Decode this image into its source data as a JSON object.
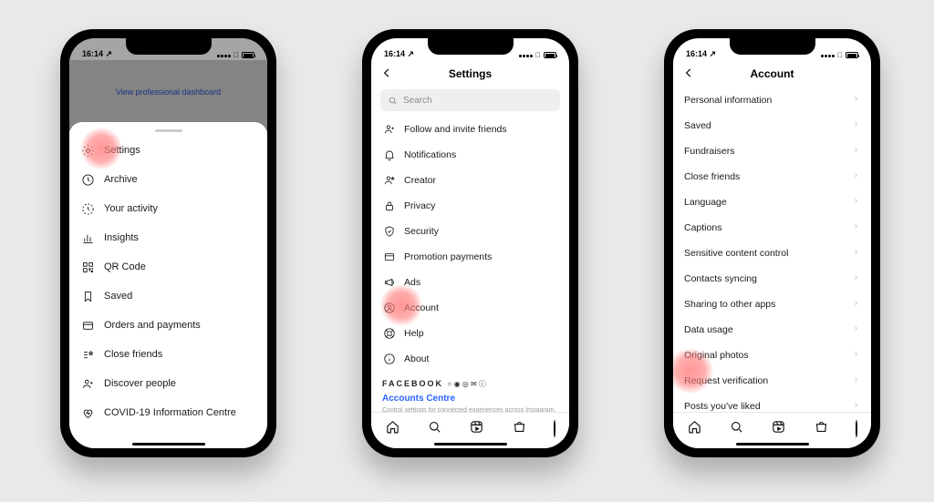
{
  "status": {
    "time": "16:14",
    "loc_arrow": "↗"
  },
  "phone1": {
    "professional_link": "View professional dashboard",
    "menu": [
      {
        "key": "settings",
        "label": "Settings"
      },
      {
        "key": "archive",
        "label": "Archive"
      },
      {
        "key": "your-activity",
        "label": "Your activity"
      },
      {
        "key": "insights",
        "label": "Insights"
      },
      {
        "key": "qr-code",
        "label": "QR Code"
      },
      {
        "key": "saved",
        "label": "Saved"
      },
      {
        "key": "orders",
        "label": "Orders and payments"
      },
      {
        "key": "close-friends",
        "label": "Close friends"
      },
      {
        "key": "discover",
        "label": "Discover people"
      },
      {
        "key": "covid",
        "label": "COVID-19 Information Centre"
      }
    ]
  },
  "phone2": {
    "title": "Settings",
    "search_placeholder": "Search",
    "items": [
      {
        "key": "follow-invite",
        "label": "Follow and invite friends"
      },
      {
        "key": "notifications",
        "label": "Notifications"
      },
      {
        "key": "creator",
        "label": "Creator"
      },
      {
        "key": "privacy",
        "label": "Privacy"
      },
      {
        "key": "security",
        "label": "Security"
      },
      {
        "key": "promotion-payments",
        "label": "Promotion payments"
      },
      {
        "key": "ads",
        "label": "Ads"
      },
      {
        "key": "account",
        "label": "Account"
      },
      {
        "key": "help",
        "label": "Help"
      },
      {
        "key": "about",
        "label": "About"
      }
    ],
    "fb_brand": "FACEBOOK",
    "accounts_centre": "Accounts Centre",
    "fb_desc": "Control settings for connected experiences across Instagram, the Facebook app and Messenger, including story and post"
  },
  "phone3": {
    "title": "Account",
    "items": [
      {
        "label": "Personal information"
      },
      {
        "label": "Saved"
      },
      {
        "label": "Fundraisers"
      },
      {
        "label": "Close friends"
      },
      {
        "label": "Language"
      },
      {
        "label": "Captions"
      },
      {
        "label": "Sensitive content control"
      },
      {
        "label": "Contacts syncing"
      },
      {
        "label": "Sharing to other apps"
      },
      {
        "label": "Data usage"
      },
      {
        "label": "Original photos"
      },
      {
        "label": "Request verification"
      },
      {
        "label": "Posts you've liked"
      }
    ]
  },
  "tabs": [
    "home",
    "search",
    "reels",
    "shop",
    "profile"
  ]
}
